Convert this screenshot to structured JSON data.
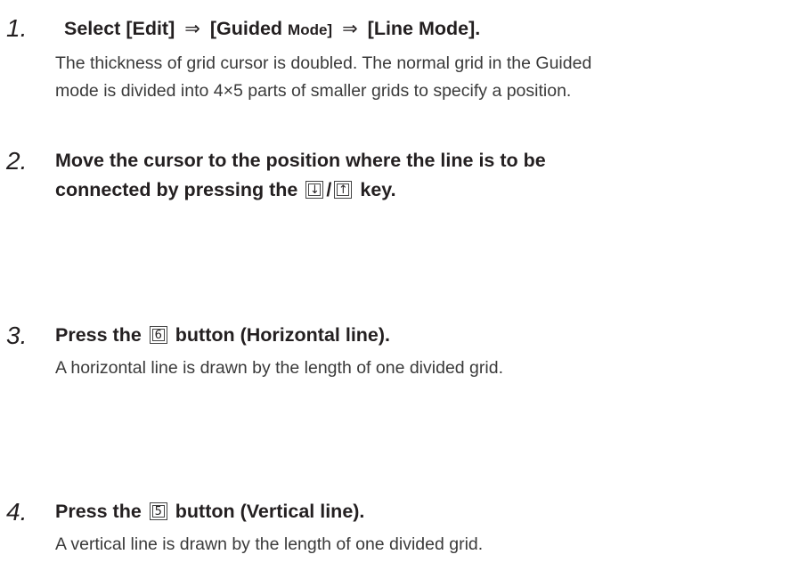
{
  "steps": [
    {
      "number": "1.",
      "title_prefix": "Select [Edit]",
      "arrow1": "⇒",
      "title_mid": "[Guided",
      "title_mode": "Mode]",
      "arrow2": "⇒",
      "title_suffix": "[Line Mode].",
      "desc_line1": "The thickness of grid cursor is doubled. The normal grid in the Guided",
      "desc_line2": "mode is divided into 4×5 parts of smaller grids to specify a position."
    },
    {
      "number": "2.",
      "head_line1": "Move the cursor to the position where the line is to be",
      "head_line2_prefix": "connected by pressing the",
      "key_down": "↓",
      "key_separator": "/",
      "key_up": "↑",
      "head_line2_suffix": "key."
    },
    {
      "number": "3.",
      "title_prefix": "Press the",
      "key": "6",
      "title_suffix": "button (Horizontal line).",
      "desc_line1": "A horizontal line is drawn by the length of one divided grid."
    },
    {
      "number": "4.",
      "title_prefix": "Press the",
      "key": "5",
      "title_suffix": "button (Vertical line).",
      "desc_line1": "A vertical line is drawn by the length of one divided grid."
    }
  ]
}
